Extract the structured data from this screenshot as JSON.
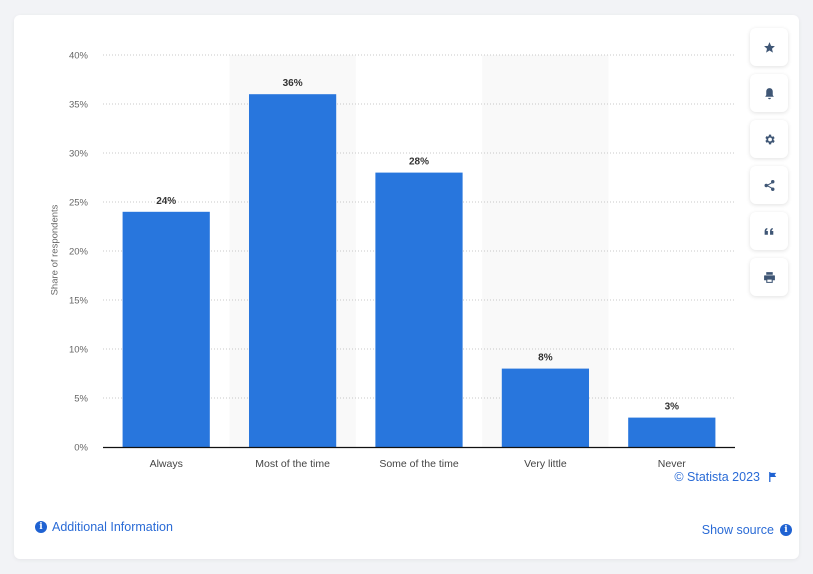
{
  "chart_data": {
    "type": "bar",
    "title": "",
    "xlabel": "",
    "ylabel": "Share of respondents",
    "categories": [
      "Always",
      "Most of the time",
      "Some of the time",
      "Very little",
      "Never"
    ],
    "values": [
      24,
      36,
      28,
      8,
      3
    ],
    "data_labels": [
      "24%",
      "36%",
      "28%",
      "8%",
      "3%"
    ],
    "ylim": [
      0,
      40
    ],
    "yticks": [
      0,
      5,
      10,
      15,
      20,
      25,
      30,
      35,
      40
    ],
    "ytick_labels": [
      "0%",
      "5%",
      "10%",
      "15%",
      "20%",
      "25%",
      "30%",
      "35%",
      "40%"
    ],
    "grid": true,
    "legend": "none",
    "bar_color": "#2876dd"
  },
  "toolbar": {
    "items": [
      {
        "name": "favorite",
        "icon": "star-icon"
      },
      {
        "name": "notification",
        "icon": "bell-icon"
      },
      {
        "name": "settings",
        "icon": "gear-icon"
      },
      {
        "name": "share",
        "icon": "share-icon"
      },
      {
        "name": "cite",
        "icon": "quote-icon"
      },
      {
        "name": "print",
        "icon": "printer-icon"
      }
    ]
  },
  "footer": {
    "copyright": "© Statista 2023",
    "show_source": "Show source",
    "additional_info": "Additional Information"
  },
  "colors": {
    "accent": "#2876dd",
    "link": "#2a6bd6"
  }
}
